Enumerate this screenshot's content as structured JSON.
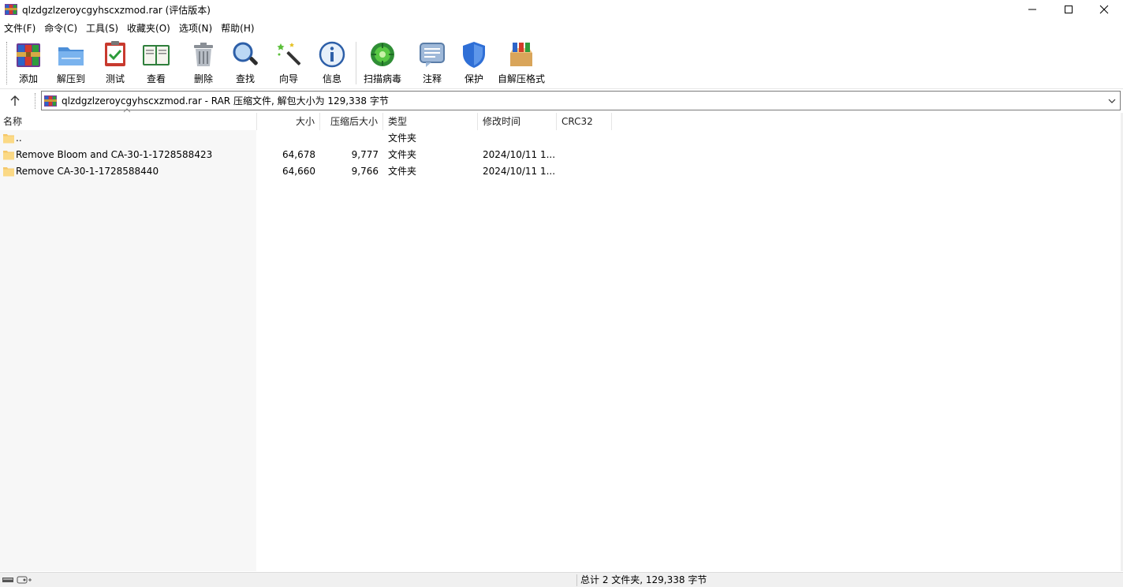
{
  "window": {
    "title": "qlzdgzlzeroycgyhscxzmod.rar (评估版本)"
  },
  "menu": [
    "文件(F)",
    "命令(C)",
    "工具(S)",
    "收藏夹(O)",
    "选项(N)",
    "帮助(H)"
  ],
  "toolbar": [
    {
      "label": "添加",
      "icon": "add-archive-icon"
    },
    {
      "label": "解压到",
      "icon": "extract-to-icon"
    },
    {
      "label": "测试",
      "icon": "test-icon"
    },
    {
      "label": "查看",
      "icon": "view-book-icon"
    },
    {
      "label": "删除",
      "icon": "trash-icon"
    },
    {
      "label": "查找",
      "icon": "magnifier-icon"
    },
    {
      "label": "向导",
      "icon": "wizard-wand-icon"
    },
    {
      "label": "信息",
      "icon": "info-icon"
    },
    {
      "label": "扫描病毒",
      "icon": "virus-scan-icon"
    },
    {
      "label": "注释",
      "icon": "comment-icon"
    },
    {
      "label": "保护",
      "icon": "shield-icon"
    },
    {
      "label": "自解压格式",
      "icon": "sfx-box-icon"
    }
  ],
  "address": {
    "text": "qlzdgzlzeroycgyhscxzmod.rar - RAR 压缩文件, 解包大小为 129,338 字节"
  },
  "columns": [
    "名称",
    "大小",
    "压缩后大小",
    "类型",
    "修改时间",
    "CRC32"
  ],
  "rows": [
    {
      "name": "..",
      "size": "",
      "packed": "",
      "type": "文件夹",
      "modified": "",
      "crc": ""
    },
    {
      "name": "Remove Bloom and CA-30-1-1728588423",
      "size": "64,678",
      "packed": "9,777",
      "type": "文件夹",
      "modified": "2024/10/11 1...",
      "crc": ""
    },
    {
      "name": "Remove CA-30-1-1728588440",
      "size": "64,660",
      "packed": "9,766",
      "type": "文件夹",
      "modified": "2024/10/11 1...",
      "crc": ""
    }
  ],
  "status": {
    "text": "总计 2 文件夹, 129,338 字节"
  },
  "colors": {
    "folder": "#f5c86a",
    "window_bg": "#ffffff",
    "name_column_bg": "#f7f7f7",
    "statusbar_bg": "#f0f0f0"
  }
}
